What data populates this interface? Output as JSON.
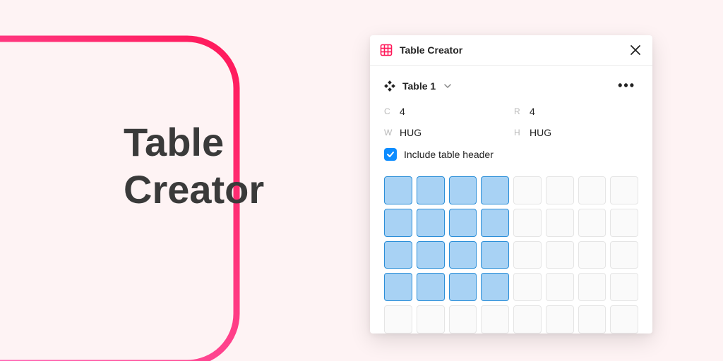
{
  "title": {
    "line1": "Table",
    "line2": "Creator"
  },
  "panel": {
    "app_name": "Table Creator",
    "table_name": "Table 1",
    "columns": {
      "label": "C",
      "value": "4"
    },
    "rows": {
      "label": "R",
      "value": "4"
    },
    "width": {
      "label": "W",
      "value": "HUG"
    },
    "height": {
      "label": "H",
      "value": "HUG"
    },
    "include_header_label": "Include table header",
    "include_header_checked": true,
    "grid": {
      "total_cols": 8,
      "total_rows": 5,
      "selected_cols": 4,
      "selected_rows": 4
    }
  },
  "colors": {
    "accent_pink": "#FF1859",
    "accent_magenta": "#FF6CC0",
    "checkbox_blue": "#0D8CFF",
    "cell_selected_fill": "#A8D2F4",
    "cell_selected_border": "#2C8FD8"
  }
}
